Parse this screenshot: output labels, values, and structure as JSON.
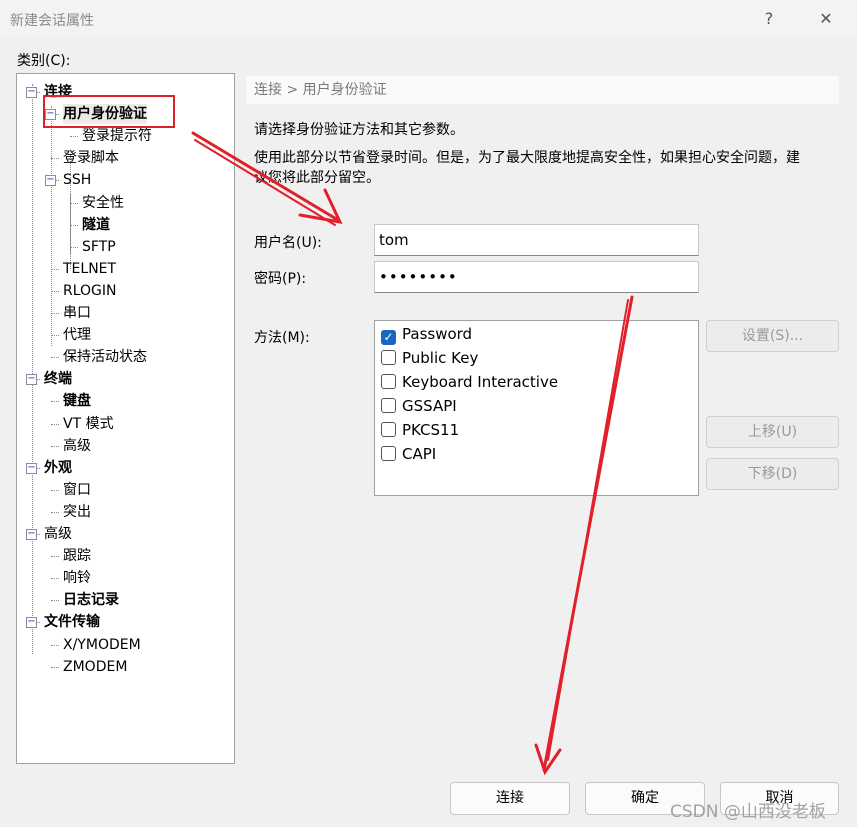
{
  "window": {
    "title": "新建会话属性",
    "help": "?",
    "close": "✕"
  },
  "category_label": "类别(C):",
  "tree": [
    {
      "label": "连接",
      "level": 0,
      "bold": true,
      "toggle": "minus"
    },
    {
      "label": "用户身份验证",
      "level": 1,
      "bold": true,
      "toggle": "minus",
      "selected": true
    },
    {
      "label": "登录提示符",
      "level": 2
    },
    {
      "label": "登录脚本",
      "level": 1
    },
    {
      "label": "SSH",
      "level": 1,
      "toggle": "minus"
    },
    {
      "label": "安全性",
      "level": 2
    },
    {
      "label": "隧道",
      "level": 2,
      "bold": true
    },
    {
      "label": "SFTP",
      "level": 2
    },
    {
      "label": "TELNET",
      "level": 1
    },
    {
      "label": "RLOGIN",
      "level": 1
    },
    {
      "label": "串口",
      "level": 1
    },
    {
      "label": "代理",
      "level": 1
    },
    {
      "label": "保持活动状态",
      "level": 1
    },
    {
      "label": "终端",
      "level": 0,
      "bold": true,
      "toggle": "minus"
    },
    {
      "label": "键盘",
      "level": 1,
      "bold": true
    },
    {
      "label": "VT 模式",
      "level": 1
    },
    {
      "label": "高级",
      "level": 1
    },
    {
      "label": "外观",
      "level": 0,
      "bold": true,
      "toggle": "minus"
    },
    {
      "label": "窗口",
      "level": 1
    },
    {
      "label": "突出",
      "level": 1
    },
    {
      "label": "高级",
      "level": 0,
      "toggle": "minus"
    },
    {
      "label": "跟踪",
      "level": 1
    },
    {
      "label": "响铃",
      "level": 1
    },
    {
      "label": "日志记录",
      "level": 1,
      "bold": true
    },
    {
      "label": "文件传输",
      "level": 0,
      "bold": true,
      "toggle": "minus"
    },
    {
      "label": "X/YMODEM",
      "level": 1
    },
    {
      "label": "ZMODEM",
      "level": 1
    }
  ],
  "panel": {
    "breadcrumb": "连接 > 用户身份验证",
    "desc1": "请选择身份验证方法和其它参数。",
    "desc2a": "使用此部分以节省登录时间。但是，为了最大限度地提高安全性，如果担心安全问题，建",
    "desc2b": "议您将此部分留空。",
    "username_label": "用户名(U):",
    "username_value": "tom",
    "password_label": "密码(P):",
    "password_value": "••••••••",
    "method_label": "方法(M):",
    "methods": [
      {
        "label": "Password",
        "checked": true
      },
      {
        "label": "Public Key",
        "checked": false
      },
      {
        "label": "Keyboard Interactive",
        "checked": false
      },
      {
        "label": "GSSAPI",
        "checked": false
      },
      {
        "label": "PKCS11",
        "checked": false
      },
      {
        "label": "CAPI",
        "checked": false
      }
    ],
    "settings_btn": "设置(S)...",
    "up_btn": "上移(U)",
    "down_btn": "下移(D)"
  },
  "footer": {
    "connect": "连接",
    "ok": "确定",
    "cancel": "取消"
  },
  "watermark": "CSDN @山西没老板",
  "colors": {
    "annotation": "#e0202a",
    "checkbox": "#1a66c4"
  }
}
